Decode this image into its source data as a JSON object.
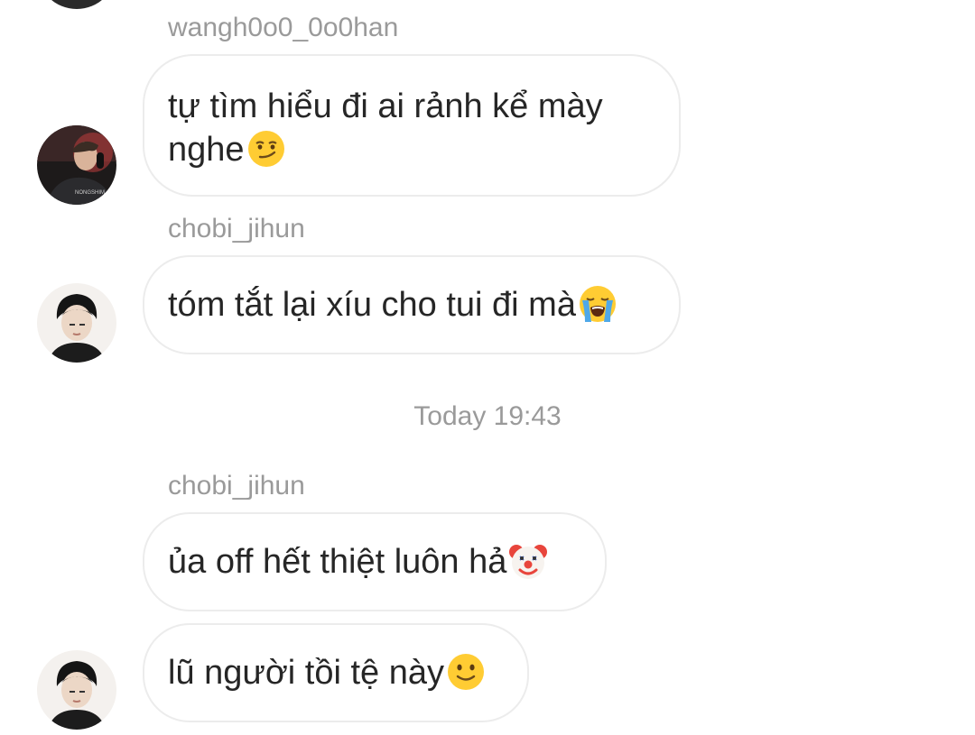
{
  "messages": [
    {
      "sender": "wangh0o0_0o0han",
      "text_line1": "tự tìm hiểu đi ai rảnh kể mày",
      "text_line2": "nghe",
      "emoji": "smirking-face"
    },
    {
      "sender": "chobi_jihun",
      "text": "tóm tắt lại xíu cho tui đi mà",
      "emoji": "loudly-crying-face"
    },
    {
      "timestamp": "Today 19:43"
    },
    {
      "sender": "chobi_jihun",
      "text": "ủa off hết thiệt luôn hả",
      "emoji": "clown-face"
    },
    {
      "text": "lũ người tồi tệ này",
      "emoji": "slightly-smiling-face"
    }
  ],
  "avatar_1_caption": "NONGSHIM"
}
